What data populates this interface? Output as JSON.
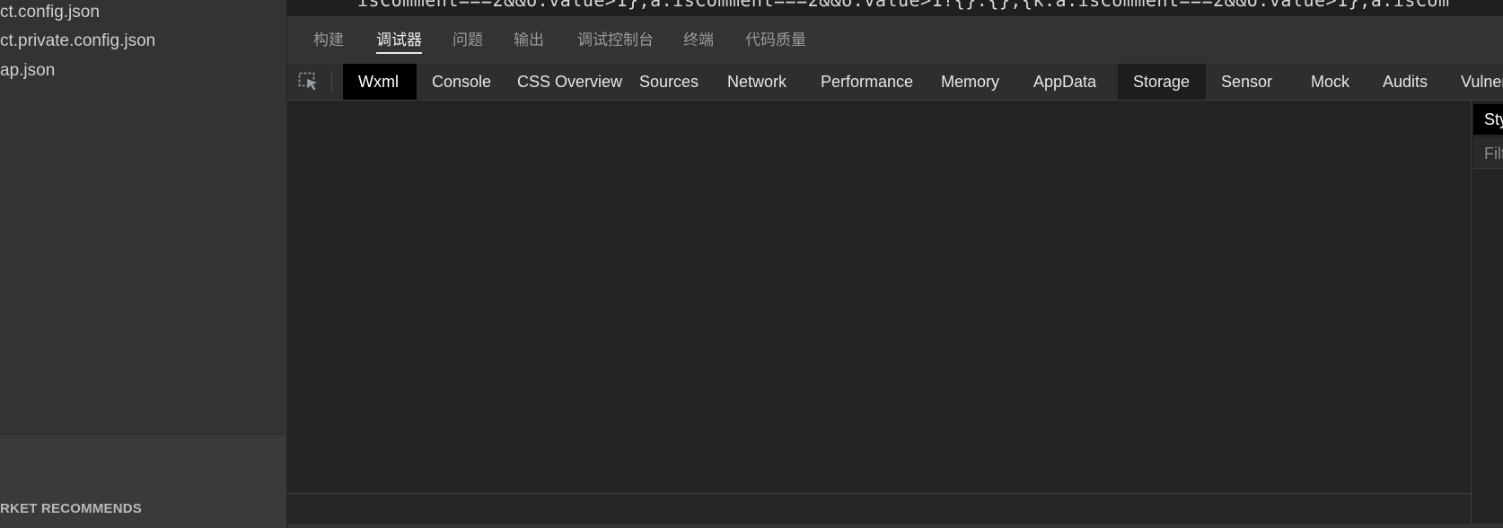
{
  "sidebar": {
    "files": [
      {
        "name": "ct.config.json"
      },
      {
        "name": "ct.private.config.json"
      },
      {
        "name": "ap.json"
      }
    ],
    "market_header": "RKET RECOMMENDS"
  },
  "editor": {
    "code_line": "isComment===2&&o.value>1},a.isComment===2&&o.value>1?{}:{},{k:a.isComment===2&&o.value>1},a.isCom"
  },
  "panel": {
    "tabs": [
      {
        "label": "构建"
      },
      {
        "label": "调试器"
      },
      {
        "label": "问题"
      },
      {
        "label": "输出"
      },
      {
        "label": "调试控制台"
      },
      {
        "label": "终端"
      },
      {
        "label": "代码质量"
      }
    ],
    "active_tab": "调试器"
  },
  "devtools": {
    "inspect_icon": "element-picker-icon",
    "tabs": [
      {
        "label": "Wxml"
      },
      {
        "label": "Console"
      },
      {
        "label": "CSS Overview"
      },
      {
        "label": "Sources"
      },
      {
        "label": "Network"
      },
      {
        "label": "Performance"
      },
      {
        "label": "Memory"
      },
      {
        "label": "AppData"
      },
      {
        "label": "Storage"
      },
      {
        "label": "Sensor"
      },
      {
        "label": "Mock"
      },
      {
        "label": "Audits"
      },
      {
        "label": "Vulnera"
      }
    ],
    "selected_tab": "Wxml",
    "hovered_tab": "Storage",
    "side_pane": {
      "styles_tab": "Sty",
      "filter_placeholder": "Filt"
    }
  },
  "colors": {
    "sidebar_bg": "#333333",
    "panel_bg": "#242424",
    "selected_tab_bg": "#000000",
    "text": "#e6e6e6"
  }
}
